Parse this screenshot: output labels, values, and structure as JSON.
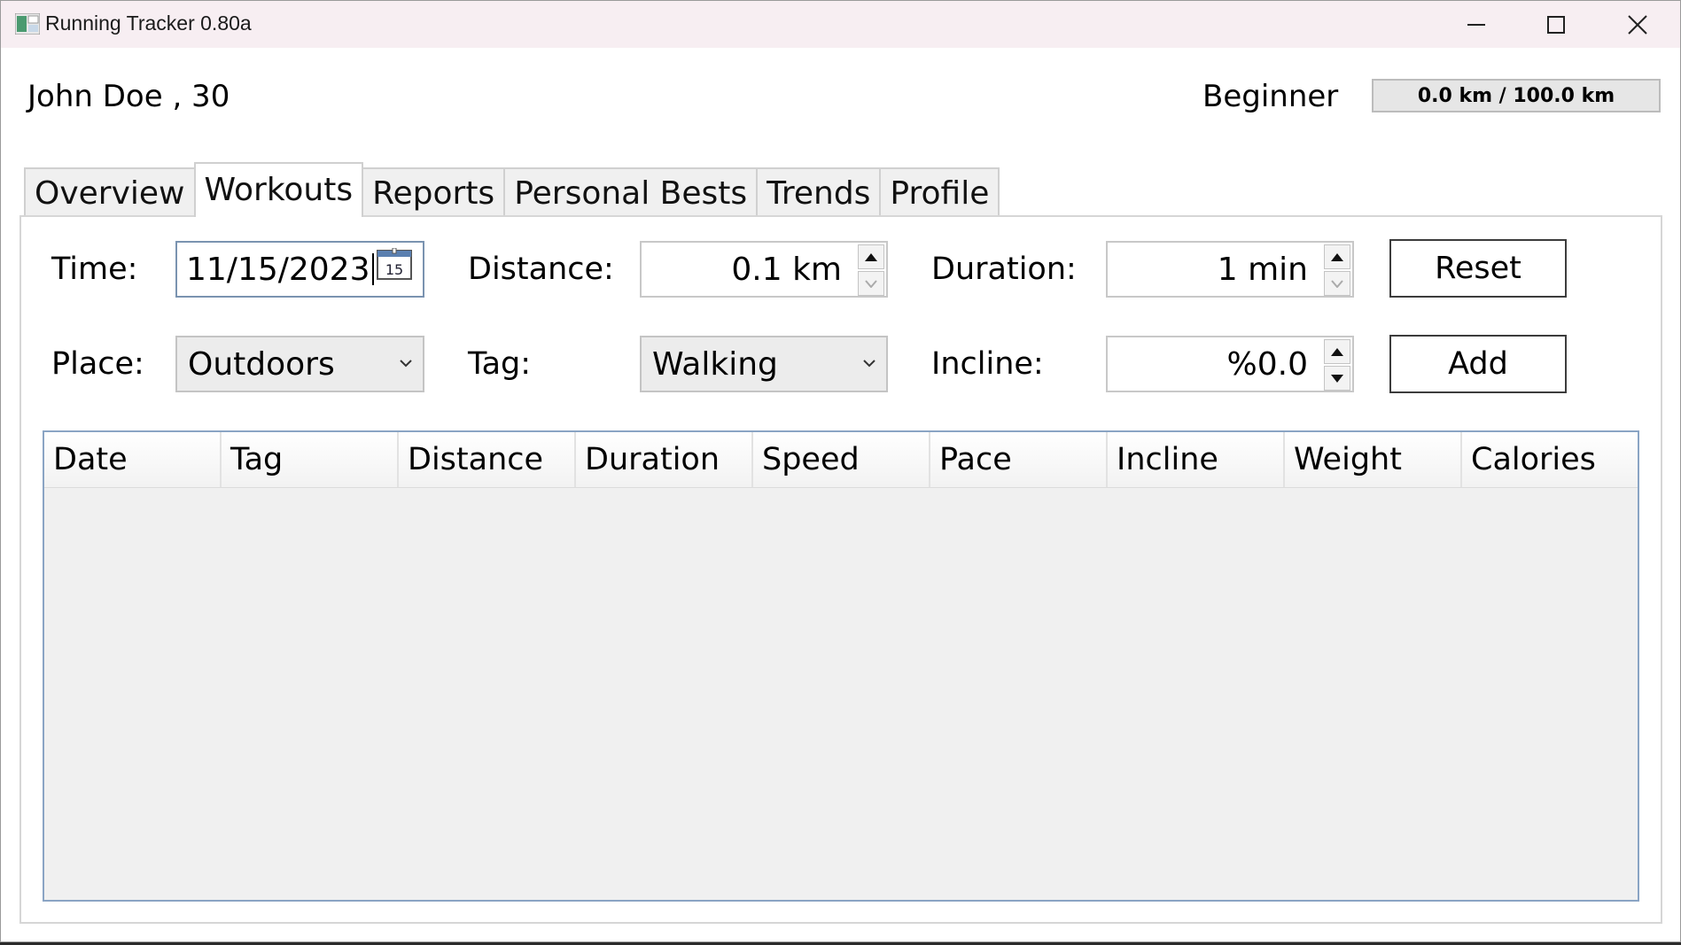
{
  "window": {
    "title": "Running Tracker 0.80a"
  },
  "header": {
    "user": "John Doe , 30",
    "level": "Beginner",
    "progress_text": "0.0 km / 100.0 km",
    "progress_fraction": 0.0
  },
  "tabs": [
    {
      "label": "Overview",
      "active": false
    },
    {
      "label": "Workouts",
      "active": true
    },
    {
      "label": "Reports",
      "active": false
    },
    {
      "label": "Personal Bests",
      "active": false
    },
    {
      "label": "Trends",
      "active": false
    },
    {
      "label": "Profile",
      "active": false
    }
  ],
  "form": {
    "time_label": "Time:",
    "time_value": "11/15/2023",
    "distance_label": "Distance:",
    "distance_value": "0.1 km",
    "duration_label": "Duration:",
    "duration_value": "1 min",
    "place_label": "Place:",
    "place_value": "Outdoors",
    "tag_label": "Tag:",
    "tag_value": "Walking",
    "incline_label": "Incline:",
    "incline_value": "%0.0",
    "reset_label": "Reset",
    "add_label": "Add"
  },
  "table": {
    "columns": [
      "Date",
      "Tag",
      "Distance",
      "Duration",
      "Speed",
      "Pace",
      "Incline",
      "Weight",
      "Calories"
    ],
    "rows": []
  },
  "calendar_icon_text": "15",
  "colors": {
    "titlebar": "#f7eef2",
    "grid_border": "#8aa4c4",
    "progress_fill": "#06b025"
  }
}
